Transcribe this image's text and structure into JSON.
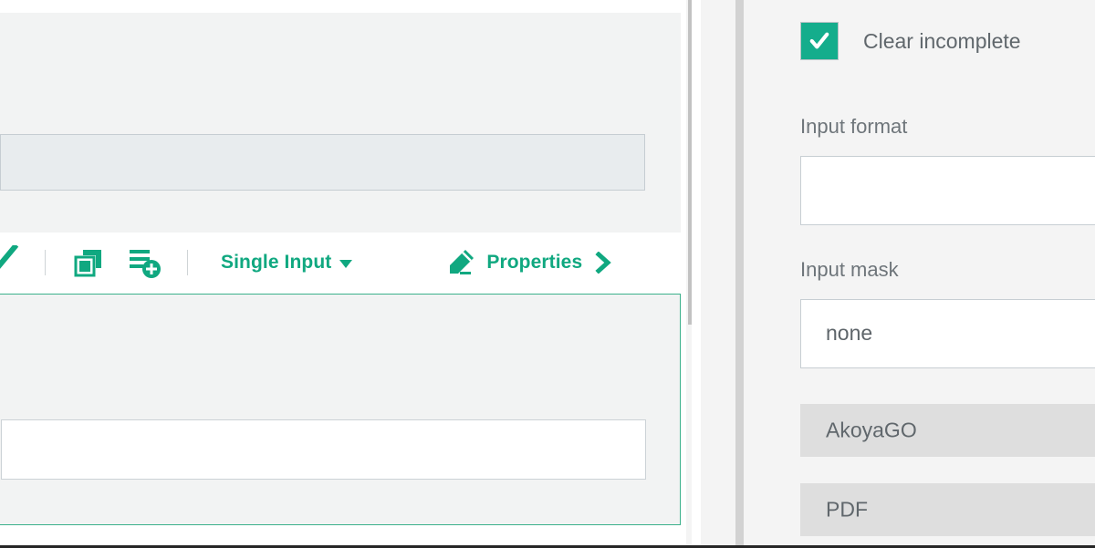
{
  "editor": {
    "toolbar": {
      "icons": [
        {
          "name": "validate-check-icon",
          "title": "Validate"
        },
        {
          "name": "duplicate-icon",
          "title": "Duplicate"
        },
        {
          "name": "add-to-list-icon",
          "title": "Add list item"
        }
      ],
      "input_mode_label": "Single Input",
      "properties_label": "Properties"
    },
    "readonly_field_value": "",
    "selected_field_value": ""
  },
  "splitter": {
    "collapse_left_glyph": "‹",
    "collapse_right_glyph": "›"
  },
  "properties": {
    "clear_incomplete": {
      "label": "Clear incomplete",
      "checked": true,
      "checkbox_color": "#14ad8c"
    },
    "input_format": {
      "label": "Input format",
      "value": ""
    },
    "input_mask": {
      "label": "Input mask",
      "value": "none"
    },
    "options": [
      {
        "label": "AkoyaGO"
      },
      {
        "label": "PDF"
      }
    ]
  },
  "colors": {
    "accent_green": "#10a880",
    "panel_bg": "#f4f4f4",
    "card_bg": "#f2f3f3",
    "readonly_bg": "#e8ecee",
    "option_bg": "#dedede"
  }
}
